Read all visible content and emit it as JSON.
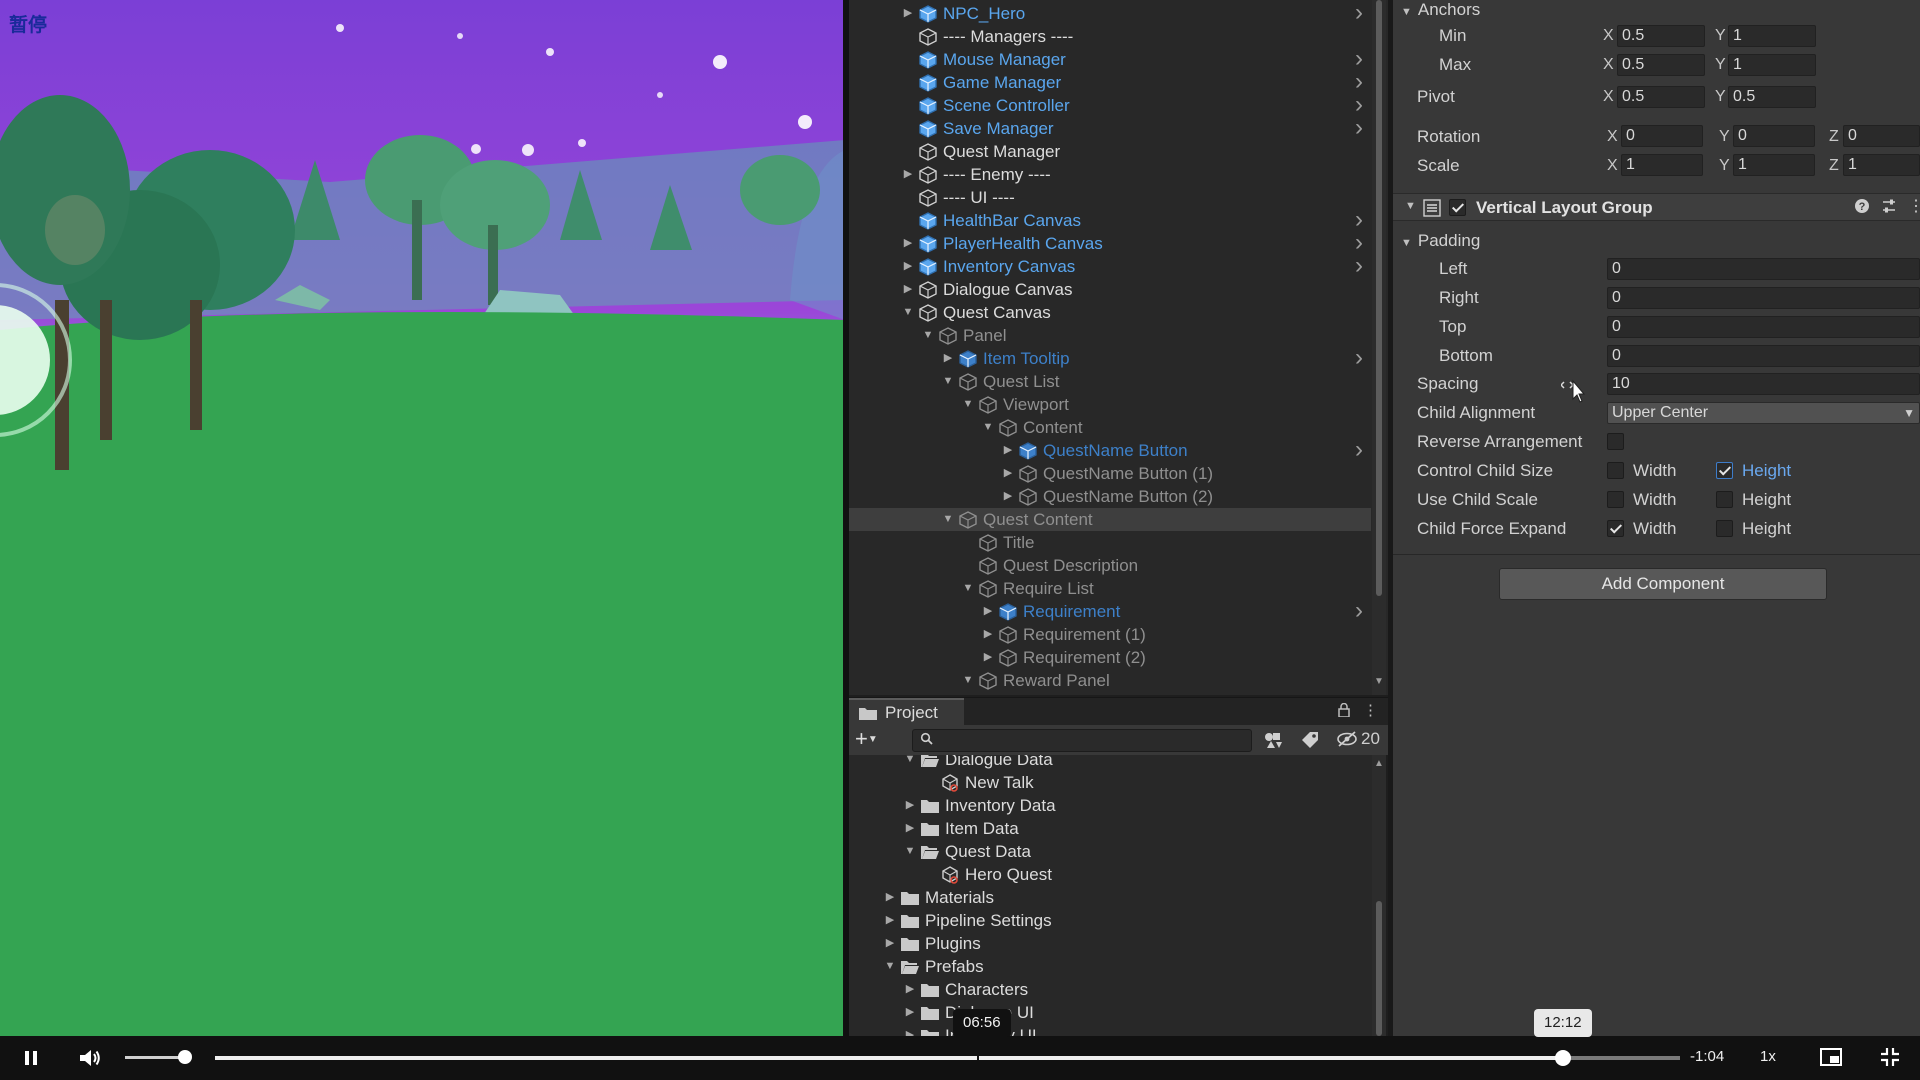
{
  "game_view": {
    "paused_label": "暂停"
  },
  "hierarchy": {
    "rows": [
      {
        "label": "NPC_Hero",
        "indent": 0,
        "arrow": "right",
        "icon": "prefab-cube-icon",
        "color": "blue",
        "chevron": true
      },
      {
        "label": "---- Managers ----",
        "indent": 0,
        "arrow": "none",
        "icon": "gameobject-cube-icon",
        "color": "white",
        "chevron": false
      },
      {
        "label": "Mouse Manager",
        "indent": 0,
        "arrow": "none",
        "icon": "prefab-cube-icon",
        "color": "blue",
        "chevron": true
      },
      {
        "label": "Game Manager",
        "indent": 0,
        "arrow": "none",
        "icon": "prefab-cube-icon",
        "color": "blue",
        "chevron": true
      },
      {
        "label": "Scene Controller",
        "indent": 0,
        "arrow": "none",
        "icon": "prefab-cube-icon",
        "color": "blue",
        "chevron": true
      },
      {
        "label": "Save Manager",
        "indent": 0,
        "arrow": "none",
        "icon": "prefab-cube-icon",
        "color": "blue",
        "chevron": true
      },
      {
        "label": "Quest Manager",
        "indent": 0,
        "arrow": "none",
        "icon": "gameobject-cube-icon",
        "color": "white",
        "chevron": false
      },
      {
        "label": "---- Enemy ----",
        "indent": 0,
        "arrow": "right",
        "icon": "gameobject-cube-icon",
        "color": "white",
        "chevron": false
      },
      {
        "label": "---- UI ----",
        "indent": 0,
        "arrow": "none",
        "icon": "gameobject-cube-icon",
        "color": "white",
        "chevron": false
      },
      {
        "label": "HealthBar Canvas",
        "indent": 0,
        "arrow": "none",
        "icon": "prefab-cube-icon",
        "color": "blue",
        "chevron": true
      },
      {
        "label": "PlayerHealth Canvas",
        "indent": 0,
        "arrow": "right",
        "icon": "prefab-cube-icon",
        "color": "blue",
        "chevron": true
      },
      {
        "label": "Inventory Canvas",
        "indent": 0,
        "arrow": "right",
        "icon": "prefab-cube-icon",
        "color": "blue",
        "chevron": true
      },
      {
        "label": "Dialogue Canvas",
        "indent": 0,
        "arrow": "right",
        "icon": "gameobject-cube-icon",
        "color": "white",
        "chevron": false
      },
      {
        "label": "Quest Canvas",
        "indent": 0,
        "arrow": "down",
        "icon": "gameobject-cube-icon",
        "color": "white",
        "chevron": false
      },
      {
        "label": "Panel",
        "indent": 1,
        "arrow": "down",
        "icon": "gameobject-cube-icon",
        "color": "dim",
        "chevron": false
      },
      {
        "label": "Item Tooltip",
        "indent": 2,
        "arrow": "right",
        "icon": "prefab-cube-icon",
        "color": "dimblue",
        "chevron": true
      },
      {
        "label": "Quest List",
        "indent": 2,
        "arrow": "down",
        "icon": "gameobject-cube-icon",
        "color": "dim",
        "chevron": false
      },
      {
        "label": "Viewport",
        "indent": 3,
        "arrow": "down",
        "icon": "gameobject-cube-icon",
        "color": "dim",
        "chevron": false
      },
      {
        "label": "Content",
        "indent": 4,
        "arrow": "down",
        "icon": "gameobject-cube-icon",
        "color": "dim",
        "chevron": false
      },
      {
        "label": "QuestName Button",
        "indent": 5,
        "arrow": "right",
        "icon": "prefab-cube-icon",
        "color": "dimblue",
        "chevron": true
      },
      {
        "label": "QuestName Button (1)",
        "indent": 5,
        "arrow": "right",
        "icon": "gameobject-cube-icon",
        "color": "dim",
        "chevron": false
      },
      {
        "label": "QuestName Button (2)",
        "indent": 5,
        "arrow": "right",
        "icon": "gameobject-cube-icon",
        "color": "dim",
        "chevron": false
      },
      {
        "label": "Quest Content",
        "indent": 2,
        "arrow": "down",
        "icon": "gameobject-cube-icon",
        "color": "dim",
        "chevron": false,
        "selected": true
      },
      {
        "label": "Title",
        "indent": 3,
        "arrow": "none",
        "icon": "gameobject-cube-icon",
        "color": "dim",
        "chevron": false
      },
      {
        "label": "Quest Description",
        "indent": 3,
        "arrow": "none",
        "icon": "gameobject-cube-icon",
        "color": "dim",
        "chevron": false
      },
      {
        "label": "Require List",
        "indent": 3,
        "arrow": "down",
        "icon": "gameobject-cube-icon",
        "color": "dim",
        "chevron": false
      },
      {
        "label": "Requirement",
        "indent": 4,
        "arrow": "right",
        "icon": "prefab-cube-icon",
        "color": "dimblue",
        "chevron": true
      },
      {
        "label": "Requirement (1)",
        "indent": 4,
        "arrow": "right",
        "icon": "gameobject-cube-icon",
        "color": "dim",
        "chevron": false
      },
      {
        "label": "Requirement (2)",
        "indent": 4,
        "arrow": "right",
        "icon": "gameobject-cube-icon",
        "color": "dim",
        "chevron": false
      },
      {
        "label": "Reward Panel",
        "indent": 3,
        "arrow": "down",
        "icon": "gameobject-cube-icon",
        "color": "dim",
        "chevron": false
      }
    ]
  },
  "project": {
    "tab_label": "Project",
    "search": {
      "value": "",
      "placeholder": ""
    },
    "hidden_count": "20",
    "rows": [
      {
        "label": "Dialogue Data",
        "indent": 1,
        "arrow": "down",
        "icon": "folder-open-icon"
      },
      {
        "label": "New Talk",
        "indent": 2,
        "arrow": "none",
        "icon": "scriptable-object-icon"
      },
      {
        "label": "Inventory Data",
        "indent": 1,
        "arrow": "right",
        "icon": "folder-icon"
      },
      {
        "label": "Item Data",
        "indent": 1,
        "arrow": "right",
        "icon": "folder-icon"
      },
      {
        "label": "Quest Data",
        "indent": 1,
        "arrow": "down",
        "icon": "folder-open-icon"
      },
      {
        "label": "Hero Quest",
        "indent": 2,
        "arrow": "none",
        "icon": "scriptable-object-icon"
      },
      {
        "label": "Materials",
        "indent": 0,
        "arrow": "right",
        "icon": "folder-icon"
      },
      {
        "label": "Pipeline Settings",
        "indent": 0,
        "arrow": "right",
        "icon": "folder-icon"
      },
      {
        "label": "Plugins",
        "indent": 0,
        "arrow": "right",
        "icon": "folder-icon"
      },
      {
        "label": "Prefabs",
        "indent": 0,
        "arrow": "down",
        "icon": "folder-open-icon"
      },
      {
        "label": "Characters",
        "indent": 1,
        "arrow": "right",
        "icon": "folder-icon"
      },
      {
        "label": "Dialogue UI",
        "indent": 1,
        "arrow": "right",
        "icon": "folder-icon"
      },
      {
        "label": "Inventory UI",
        "indent": 1,
        "arrow": "right",
        "icon": "folder-icon"
      }
    ]
  },
  "inspector": {
    "anchors": {
      "label": "Anchors",
      "min_label": "Min",
      "min_x": "0.5",
      "min_y": "1",
      "max_label": "Max",
      "max_x": "0.5",
      "max_y": "1"
    },
    "pivot": {
      "label": "Pivot",
      "x": "0.5",
      "y": "0.5"
    },
    "rotation": {
      "label": "Rotation",
      "x": "0",
      "y": "0",
      "z": "0"
    },
    "scale": {
      "label": "Scale",
      "x": "1",
      "y": "1",
      "z": "1"
    },
    "axes": {
      "x": "X",
      "y": "Y",
      "z": "Z"
    },
    "component_title": "Vertical Layout Group",
    "component_enabled": true,
    "padding": {
      "label": "Padding",
      "left_label": "Left",
      "left": "0",
      "right_label": "Right",
      "right": "0",
      "top_label": "Top",
      "top": "0",
      "bottom_label": "Bottom",
      "bottom": "0"
    },
    "spacing": {
      "label": "Spacing",
      "value": "10"
    },
    "child_alignment": {
      "label": "Child Alignment",
      "value": "Upper Center"
    },
    "reverse_arrangement": {
      "label": "Reverse Arrangement",
      "checked": false
    },
    "control_child_size": {
      "label": "Control Child Size",
      "width_label": "Width",
      "width": false,
      "height_label": "Height",
      "height": true
    },
    "use_child_scale": {
      "label": "Use Child Scale",
      "width_label": "Width",
      "width": false,
      "height_label": "Height",
      "height": false
    },
    "child_force_expand": {
      "label": "Child Force Expand",
      "width_label": "Width",
      "width": true,
      "height_label": "Height",
      "height": false
    },
    "add_component_label": "Add Component"
  },
  "player": {
    "remaining_time": "-1:04",
    "speed": "1x",
    "hover_time": "06:56",
    "current_time": "12:12",
    "progress_fraction": 0.92,
    "hover_fraction": 0.52,
    "volume_fraction": 0.85
  },
  "colors": {
    "prefab_blue": "#5aa6ee",
    "sky_purple": "#8e44d6",
    "grass_green": "#35a553",
    "editor_dark": "#282828",
    "inspector_bg": "#383838"
  }
}
